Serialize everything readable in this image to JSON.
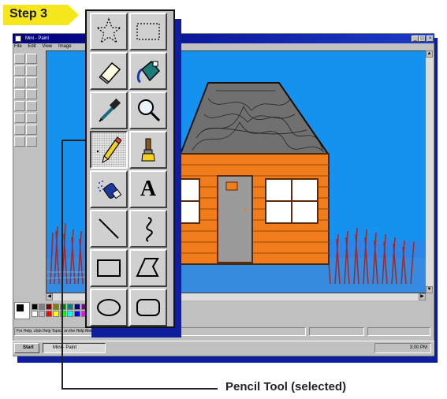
{
  "step": {
    "label": "Step 3",
    "color": "#f5e61e"
  },
  "window": {
    "title": "Mini - Paint",
    "menu": [
      "File",
      "Edit",
      "View",
      "Image"
    ]
  },
  "toolbox": {
    "tools": [
      {
        "name": "free-form-select",
        "icon": "star-select-icon"
      },
      {
        "name": "select",
        "icon": "rect-select-icon"
      },
      {
        "name": "eraser",
        "icon": "eraser-icon"
      },
      {
        "name": "fill-with-color",
        "icon": "paint-bucket-icon"
      },
      {
        "name": "pick-color",
        "icon": "eyedropper-icon"
      },
      {
        "name": "magnifier",
        "icon": "magnifier-icon"
      },
      {
        "name": "pencil",
        "icon": "pencil-icon",
        "selected": true
      },
      {
        "name": "brush",
        "icon": "brush-icon"
      },
      {
        "name": "airbrush",
        "icon": "airbrush-icon"
      },
      {
        "name": "text",
        "icon": "text-icon",
        "glyph": "A"
      },
      {
        "name": "line",
        "icon": "line-icon"
      },
      {
        "name": "curve",
        "icon": "curve-icon"
      },
      {
        "name": "rectangle",
        "icon": "rectangle-icon"
      },
      {
        "name": "polygon",
        "icon": "polygon-icon"
      },
      {
        "name": "ellipse",
        "icon": "ellipse-icon"
      },
      {
        "name": "rounded-rectangle",
        "icon": "rounded-rect-icon"
      }
    ]
  },
  "status": {
    "help_text": "For Help, click Help Topics on the Help Menu.",
    "coords": "",
    "size": ""
  },
  "taskbar": {
    "start": "Start",
    "task": "Mini - Paint",
    "clock": "3:00 PM"
  },
  "callout": {
    "label": "Pencil Tool (selected)"
  },
  "colors": {
    "canvas_sky": "#1591f0",
    "house_wall": "#f07c1c",
    "roof": "#707070",
    "door": "#9a9a9a",
    "window_shadow": "#0f1e9c"
  }
}
